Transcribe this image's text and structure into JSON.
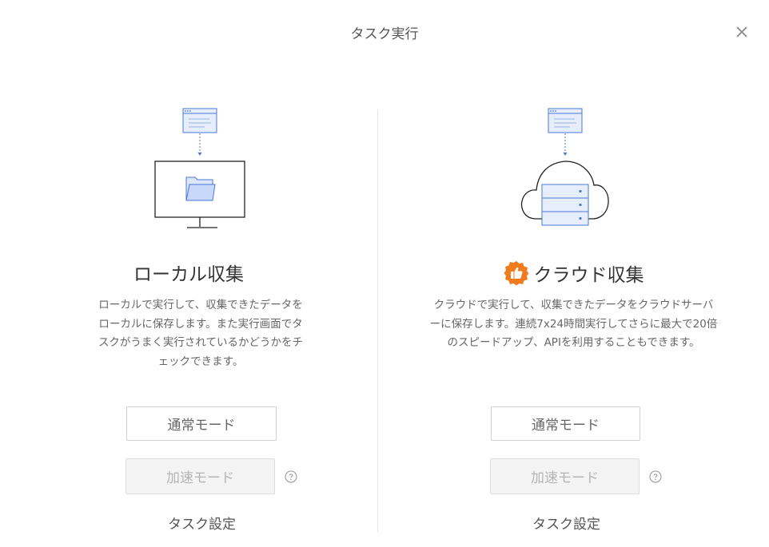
{
  "dialog": {
    "title": "タスク実行"
  },
  "local": {
    "title": "ローカル収集",
    "description_lines": [
      "ローカルで実行して、収集できたデータを",
      "ローカルに保存します。また実行画面でタ",
      "スクがうまく実行されているかどうかをチ",
      "ェックできます。"
    ],
    "normal_mode": "通常モード",
    "accelerated_mode": "加速モード",
    "settings": "タスク設定"
  },
  "cloud": {
    "title": "クラウド収集",
    "badge_icon": "thumbs-up-icon",
    "description_lines": [
      "クラウドで実行して、収集できたデータをクラウドサーバ",
      "ーに保存します。連続7x24時間実行してさらに最大で20倍",
      "のスピードアップ、APIを利用することもできます。"
    ],
    "normal_mode": "通常モード",
    "accelerated_mode": "加速モード",
    "settings": "タスク設定"
  },
  "colors": {
    "accent_blue": "#4a78d8",
    "badge_orange": "#f07c1d",
    "disabled_bg": "#f4f4f4"
  }
}
